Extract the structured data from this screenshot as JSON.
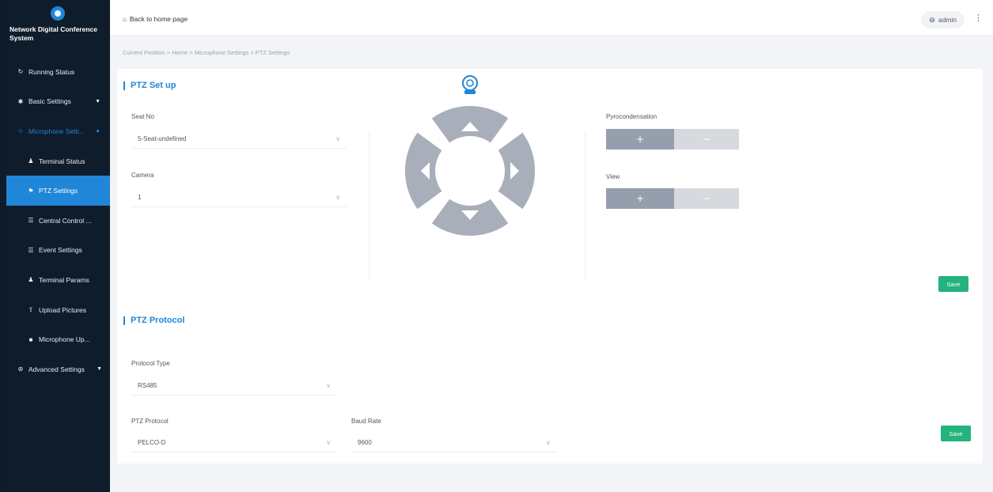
{
  "app": {
    "title": "Network Digital Conference System"
  },
  "sidebar": {
    "items": [
      {
        "label": "Running Status",
        "icon": "refresh-icon"
      },
      {
        "label": "Basic Settings",
        "icon": "gear-icon"
      },
      {
        "label": "Microphone Setti...",
        "icon": "microphone-icon"
      },
      {
        "label": "Terminal Status",
        "icon": "user-icon"
      },
      {
        "label": "PTZ Settings",
        "icon": "flag-icon"
      },
      {
        "label": "Central Control ...",
        "icon": "list-icon"
      },
      {
        "label": "Event Settings",
        "icon": "list-icon"
      },
      {
        "label": "Terminal Params",
        "icon": "users-icon"
      },
      {
        "label": "Upload Pictures",
        "icon": "upload-icon"
      },
      {
        "label": "Microphone Up...",
        "icon": "chip-icon"
      },
      {
        "label": "Advanced Settings",
        "icon": "settings-icon"
      }
    ]
  },
  "topbar": {
    "back_label": "Back to home page",
    "user_label": "admin"
  },
  "breadcrumb": "Current Position  >  Home  >  Microphone Settings  >  PTZ Settings",
  "ptz_setup": {
    "title": "PTZ Set up",
    "seat_label": "Seat No",
    "seat_value": "5-Seat-undefined",
    "camera_label": "Camera",
    "camera_value": "1",
    "pyro_label": "Pyrocondensation",
    "view_label": "View",
    "plus": "+",
    "minus": "−",
    "save_label": "Save"
  },
  "ptz_protocol": {
    "title": "PTZ Protocol",
    "type_label": "Protocol Type",
    "type_value": "RS485",
    "protocol_label": "PTZ Protocol",
    "protocol_value": "PELCO-D",
    "baud_label": "Baud Rate",
    "baud_value": "9600",
    "save_label": "Save"
  },
  "colors": {
    "accent": "#1f86d8",
    "sidebar_bg": "#0f1c2b",
    "save_green": "#24b37c",
    "pad_gray": "#a8afba"
  }
}
